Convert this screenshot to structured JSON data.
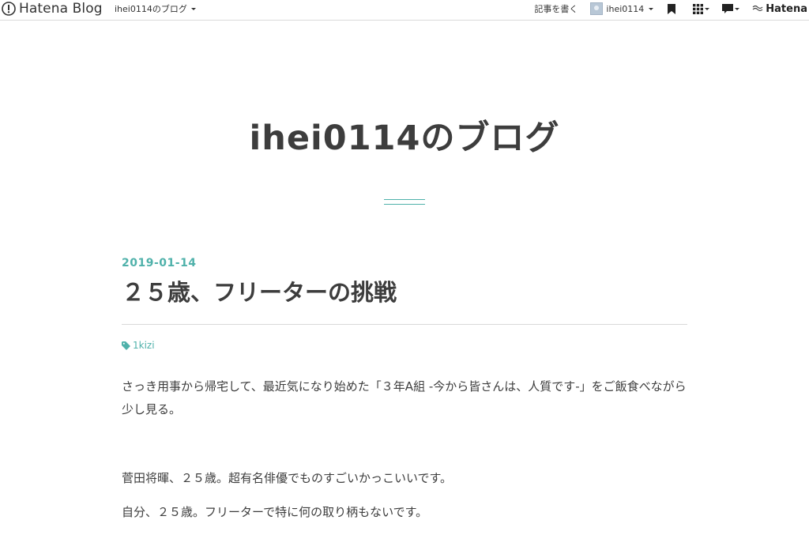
{
  "header": {
    "logo_text": "Hatena Blog",
    "blog_selector": "ihei0114のブログ",
    "write_label": "記事を書く",
    "user_name": "ihei0114",
    "hatena_label": "Hatena",
    "icons": {
      "logo": "hatena-logo-icon",
      "bookmark": "bookmark-icon",
      "apps": "apps-grid-icon",
      "notify": "notification-icon",
      "hatena": "hatena-wave-icon"
    }
  },
  "blog": {
    "title": "ihei0114のブログ"
  },
  "entry": {
    "date": "2019-01-14",
    "title": "２５歳、フリーターの挑戦",
    "category": "1kizi",
    "paragraphs": [
      "さっき用事から帰宅して、最近気になり始めた「３年A組 -今から皆さんは、人質です-」をご飯食べながら少し見る。",
      "菅田将暉、２５歳。超有名俳優でものすごいかっこいいです。",
      "自分、２５歳。フリーターで特に何の取り柄もないです。"
    ]
  },
  "colors": {
    "accent": "#4fb1aa",
    "text": "#3d3d3d",
    "border": "#d9d9d9"
  }
}
